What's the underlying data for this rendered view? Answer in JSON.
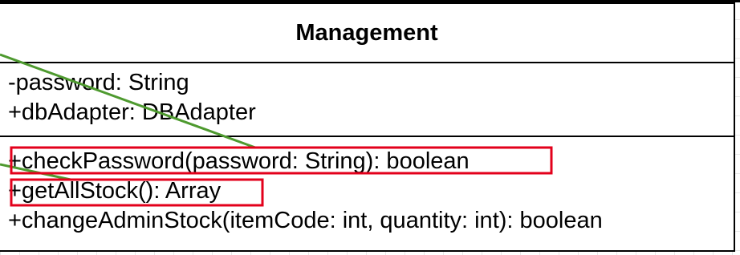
{
  "diagram": {
    "class_name": "Management",
    "attributes": [
      "-password: String",
      "+dbAdapter: DBAdapter"
    ],
    "methods": [
      "+checkPassword(password: String): boolean",
      "+getAllStock(): Array",
      "+changeAdminStock(itemCode: int, quantity: int): boolean"
    ]
  },
  "colors": {
    "highlight": "#e3001b",
    "connector": "#4e9a2f",
    "border": "#000000"
  }
}
